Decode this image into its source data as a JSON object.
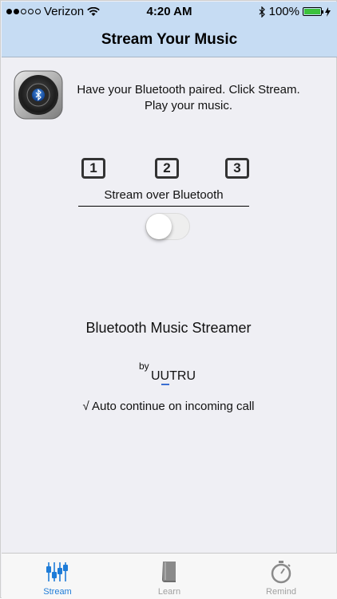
{
  "status_bar": {
    "carrier": "Verizon",
    "time": "4:20 AM",
    "battery": "100%"
  },
  "nav": {
    "title": "Stream Your Music"
  },
  "instructions": {
    "line1": "Have your Bluetooth paired. Click Stream.",
    "line2": "Play your music."
  },
  "steps": [
    "1",
    "2",
    "3"
  ],
  "stream_label": "Stream over Bluetooth",
  "toggle": {
    "on": false
  },
  "app_name": "Bluetooth Music Streamer",
  "by_label": "by",
  "company": "UUTRU",
  "auto_continue": "√ Auto continue on incoming call",
  "tabs": [
    {
      "label": "Stream",
      "icon": "equalizer-icon",
      "active": true
    },
    {
      "label": "Learn",
      "icon": "book-icon",
      "active": false
    },
    {
      "label": "Remind",
      "icon": "stopwatch-icon",
      "active": false
    }
  ],
  "colors": {
    "bar_bg": "#c6dcf3",
    "accent": "#1e7cd8",
    "battery": "#3cc23c"
  }
}
